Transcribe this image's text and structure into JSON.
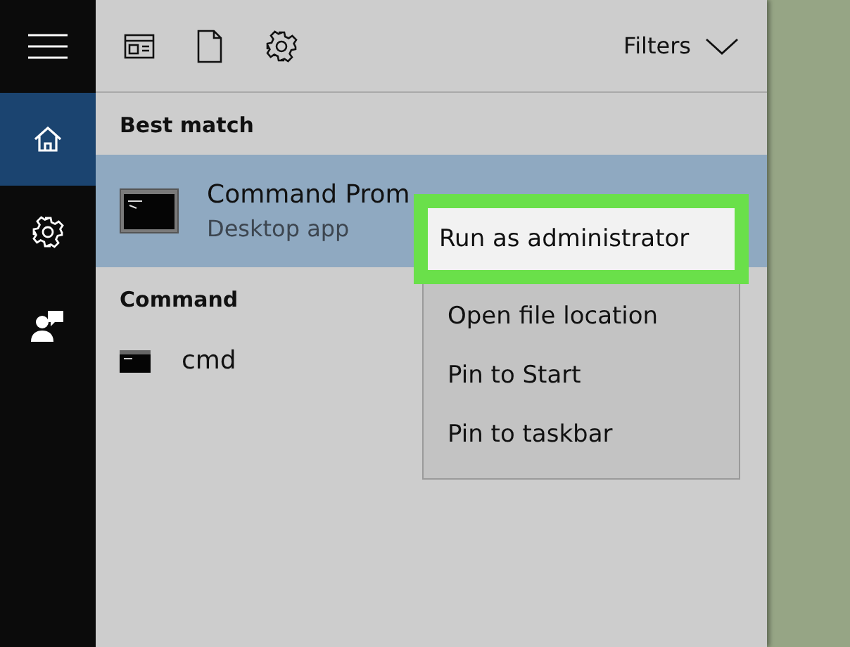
{
  "sidebar": {
    "items": [
      {
        "selected": true
      },
      {
        "selected": false
      },
      {
        "selected": false
      }
    ]
  },
  "toolbar": {
    "filters": "Filters"
  },
  "sections": [
    {
      "header": "Best match",
      "results": [
        {
          "title": "Command Prom",
          "subtitle": "Desktop app",
          "selected": true
        }
      ]
    },
    {
      "header": "Command",
      "results": [
        {
          "title": "cmd",
          "selected": false
        }
      ]
    }
  ],
  "context_menu": [
    {
      "label": "Run as administrator",
      "selected": true
    },
    {
      "label": "Open file location",
      "selected": false
    },
    {
      "label": "Pin to Start",
      "selected": false
    },
    {
      "label": "Pin to taskbar",
      "selected": false
    }
  ]
}
